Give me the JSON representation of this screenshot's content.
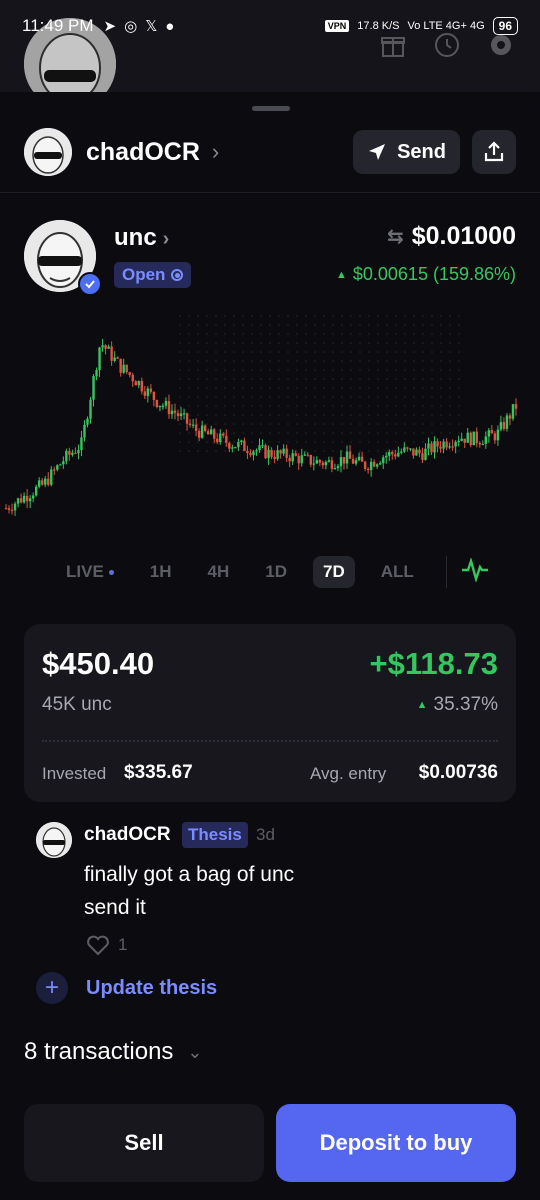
{
  "status_bar": {
    "time": "11:49 PM",
    "speed": "17.8 K/S",
    "network": "Vo LTE 4G+ 4G",
    "battery": "96"
  },
  "header": {
    "user_name": "chadOCR",
    "send_label": "Send"
  },
  "token": {
    "name": "unc",
    "status": "Open",
    "price": "$0.01000",
    "change": "$0.00615 (159.86%)",
    "change_direction": "up"
  },
  "chart_data": {
    "type": "candlestick",
    "range": "7D",
    "x": "time",
    "y": "price",
    "trend": [
      0.0025,
      0.003,
      0.0035,
      0.0045,
      0.0052,
      0.0095,
      0.0085,
      0.0078,
      0.007,
      0.0065,
      0.0058,
      0.0055,
      0.0052,
      0.005,
      0.0048,
      0.0047,
      0.0045,
      0.0044,
      0.0046,
      0.0043,
      0.0047,
      0.0049,
      0.0048,
      0.0052,
      0.0055,
      0.0054,
      0.0056,
      0.0068
    ],
    "up_color": "#33c760",
    "down_color": "#e0533e"
  },
  "ranges": {
    "items": [
      "LIVE",
      "1H",
      "4H",
      "1D",
      "7D",
      "ALL"
    ],
    "active": "7D"
  },
  "position": {
    "value": "$450.40",
    "pnl": "+$118.73",
    "quantity": "45K unc",
    "pnl_pct": "35.37%",
    "invested_label": "Invested",
    "invested_value": "$335.67",
    "avg_label": "Avg. entry",
    "avg_value": "$0.00736"
  },
  "thesis": {
    "author": "chadOCR",
    "badge": "Thesis",
    "time": "3d",
    "body": "finally got a bag of unc\nsend it",
    "likes": "1"
  },
  "update_label": "Update thesis",
  "transactions_label": "8 transactions",
  "actions": {
    "sell": "Sell",
    "buy": "Deposit to buy"
  },
  "colors": {
    "accent": "#5567f0",
    "positive": "#33c760",
    "background": "#0b0b10"
  }
}
